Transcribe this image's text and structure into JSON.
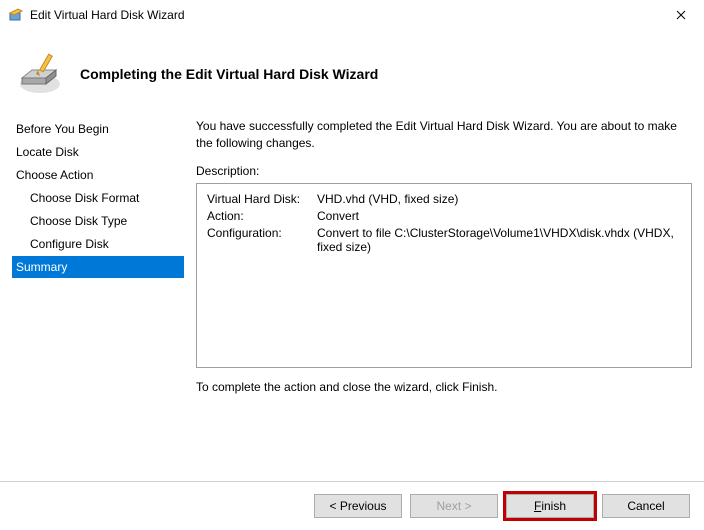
{
  "window": {
    "title": "Edit Virtual Hard Disk Wizard"
  },
  "header": {
    "title": "Completing the Edit Virtual Hard Disk Wizard"
  },
  "sidebar": {
    "items": [
      {
        "label": "Before You Begin",
        "sub": false,
        "selected": false
      },
      {
        "label": "Locate Disk",
        "sub": false,
        "selected": false
      },
      {
        "label": "Choose Action",
        "sub": false,
        "selected": false
      },
      {
        "label": "Choose Disk Format",
        "sub": true,
        "selected": false
      },
      {
        "label": "Choose Disk Type",
        "sub": true,
        "selected": false
      },
      {
        "label": "Configure Disk",
        "sub": true,
        "selected": false
      },
      {
        "label": "Summary",
        "sub": false,
        "selected": true
      }
    ]
  },
  "content": {
    "intro": "You have successfully completed the Edit Virtual Hard Disk Wizard. You are about to make the following changes.",
    "description_label": "Description:",
    "rows": [
      {
        "key": "Virtual Hard Disk:",
        "value": "VHD.vhd (VHD, fixed size)"
      },
      {
        "key": "Action:",
        "value": "Convert"
      },
      {
        "key": "Configuration:",
        "value": "Convert to file C:\\ClusterStorage\\Volume1\\VHDX\\disk.vhdx (VHDX, fixed size)"
      }
    ],
    "finish_text": "To complete the action and close the wizard, click Finish."
  },
  "footer": {
    "previous": "< Previous",
    "next": "Next >",
    "finish": "Finish",
    "cancel": "Cancel"
  }
}
